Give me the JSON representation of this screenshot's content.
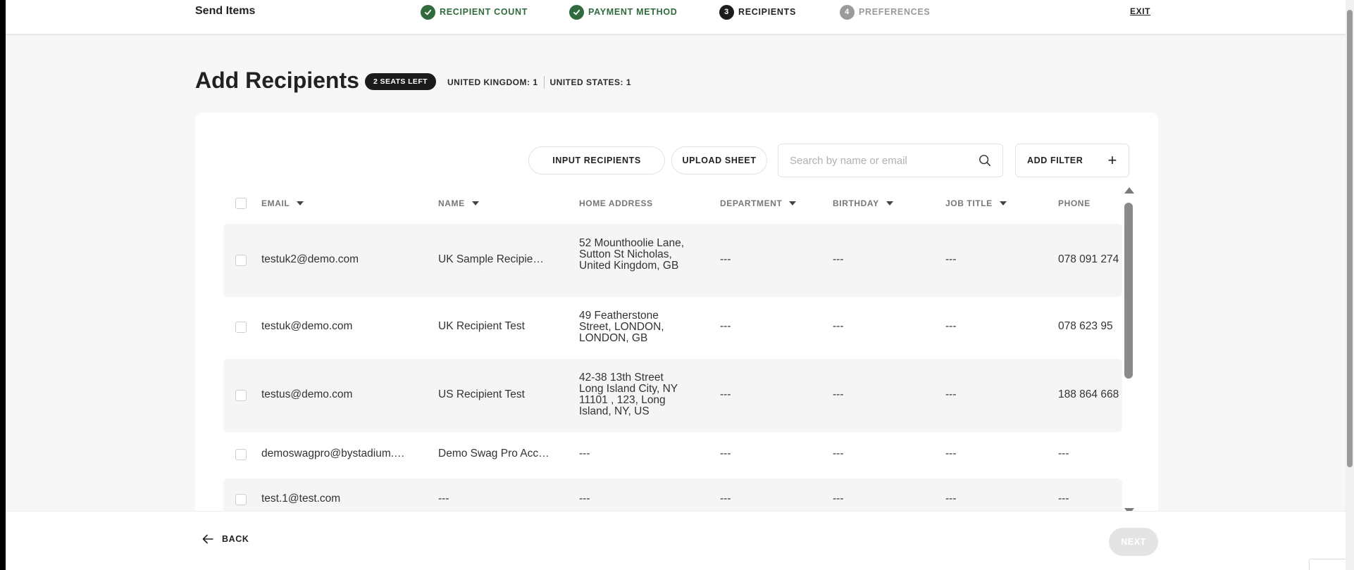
{
  "header": {
    "brand": "Send Items",
    "steps": [
      {
        "num": "",
        "label": "RECIPIENT COUNT",
        "state": "done"
      },
      {
        "num": "",
        "label": "PAYMENT METHOD",
        "state": "done"
      },
      {
        "num": "3",
        "label": "RECIPIENTS",
        "state": "active"
      },
      {
        "num": "4",
        "label": "PREFERENCES",
        "state": "todo"
      }
    ],
    "exit_label": "EXIT"
  },
  "page": {
    "title": "Add Recipients",
    "seats_badge": "2 SEATS LEFT",
    "country_counts": [
      "UNITED KINGDOM: 1",
      "UNITED STATES: 1"
    ]
  },
  "toolbar": {
    "input_recipients": "INPUT RECIPIENTS",
    "upload_sheet": "UPLOAD SHEET",
    "search_placeholder": "Search by name or email",
    "add_filter": "ADD FILTER"
  },
  "table": {
    "columns": [
      "EMAIL",
      "NAME",
      "HOME ADDRESS",
      "DEPARTMENT",
      "BIRTHDAY",
      "JOB TITLE",
      "PHONE"
    ],
    "rows": [
      {
        "email": "testuk2@demo.com",
        "name": "UK Sample Recipie…",
        "address": "52 Mounthoolie Lane, Sutton St Nicholas, United Kingdom, GB",
        "department": "---",
        "birthday": "---",
        "job_title": "---",
        "phone": "078 091 274"
      },
      {
        "email": "testuk@demo.com",
        "name": "UK Recipient Test",
        "address": "49 Featherstone Street,   LONDON, LONDON, GB",
        "department": "---",
        "birthday": "---",
        "job_title": "---",
        "phone": "078 623 95"
      },
      {
        "email": "testus@demo.com",
        "name": "US Recipient Test",
        "address": "42-38 13th Street Long Island City, NY 11101 , 123, Long Island, NY, US",
        "department": "---",
        "birthday": "---",
        "job_title": "---",
        "phone": "188 864 668"
      },
      {
        "email": "demoswagpro@bystadium.…",
        "name": "Demo Swag Pro Acc…",
        "address": "---",
        "department": "---",
        "birthday": "---",
        "job_title": "---",
        "phone": "---"
      },
      {
        "email": "test.1@test.com",
        "name": "---",
        "address": "---",
        "department": "---",
        "birthday": "---",
        "job_title": "---",
        "phone": "---"
      }
    ]
  },
  "footer": {
    "back_label": "BACK",
    "next_label": "NEXT"
  },
  "colors": {
    "done": "#2f6b3c",
    "active": "#1b1b1b",
    "todo": "#9a9a9a",
    "next_disabled": "#e4e4e4"
  }
}
